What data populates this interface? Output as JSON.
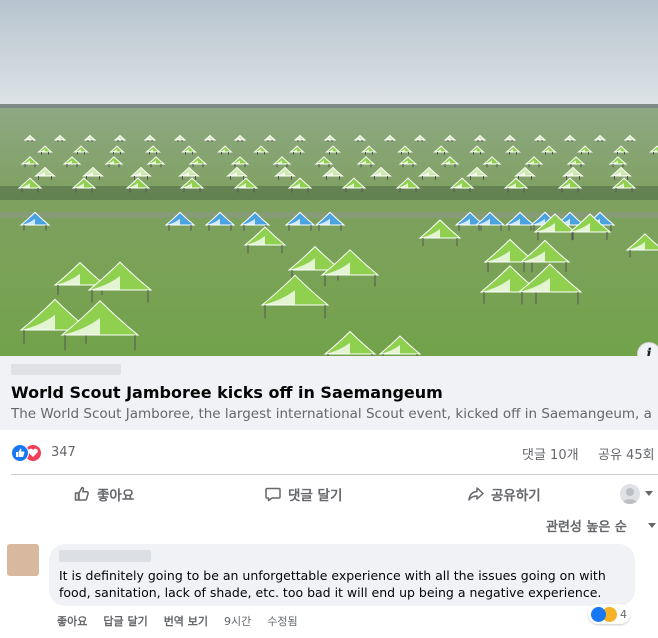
{
  "post": {
    "link_title": "World Scout Jamboree kicks off in Saemangeum",
    "link_description": "The World Scout Jamboree, the largest international Scout event, kicked off in Saemangeum, a re...",
    "info_glyph": "i"
  },
  "stats": {
    "reaction_count": "347",
    "comments": "댓글 10개",
    "shares": "공유 45회",
    "reaction_icons": [
      "like-icon",
      "love-icon"
    ],
    "colors": {
      "like": "#1877f2",
      "love": "#f33e58"
    }
  },
  "actions": {
    "like": "좋아요",
    "comment": "댓글 달기",
    "share": "공유하기"
  },
  "comments": {
    "sort_label": "관련성 높은 순",
    "items": [
      {
        "text": "It is definitely going to be an unforgettable experience with all the issues going on with food, sanitation, lack of shade, etc. too bad it will end up being a negative experience.",
        "reaction_count": "4",
        "like_label": "좋아요",
        "reply_label": "답글 달기",
        "translate_label": "번역 보기",
        "time": "9시간",
        "edited": "수정됨"
      }
    ]
  }
}
